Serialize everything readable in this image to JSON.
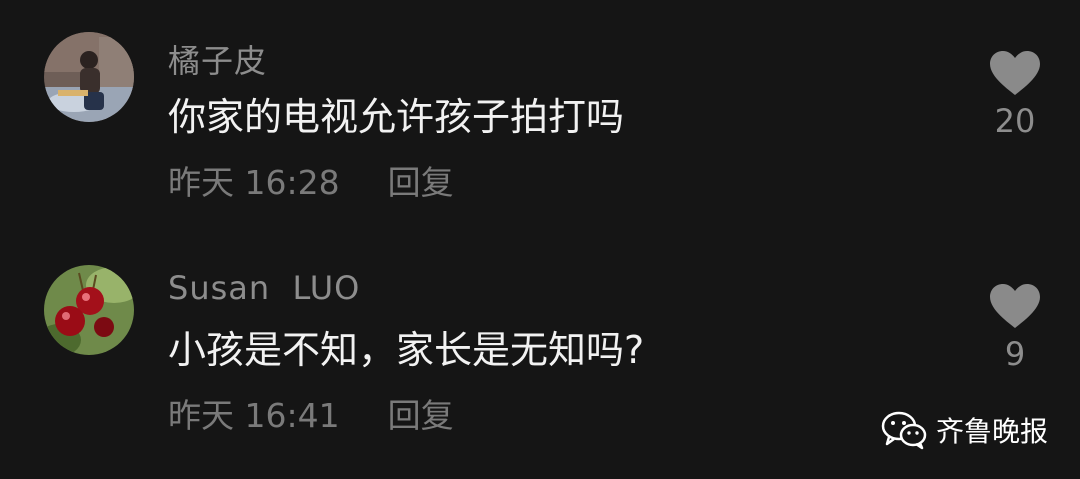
{
  "comments": [
    {
      "username": "橘子皮",
      "text": "你家的电视允许孩子拍打吗",
      "time": "昨天 16:28",
      "reply_label": "回复",
      "like_count": "20",
      "avatar_icon": "user-photo-avatar"
    },
    {
      "username": "Susan  LUO",
      "text": "小孩是不知，家长是无知吗?",
      "time": "昨天 16:41",
      "reply_label": "回复",
      "like_count": "9",
      "avatar_icon": "cherry-photo-avatar"
    }
  ],
  "watermark": {
    "brand": "齐鲁晚报",
    "icon": "wechat-icon"
  },
  "colors": {
    "background": "#151515",
    "username": "#8d8d8d",
    "text": "#f2f2f2",
    "meta": "#7a7a7a",
    "heart": "#8a8a8a"
  }
}
